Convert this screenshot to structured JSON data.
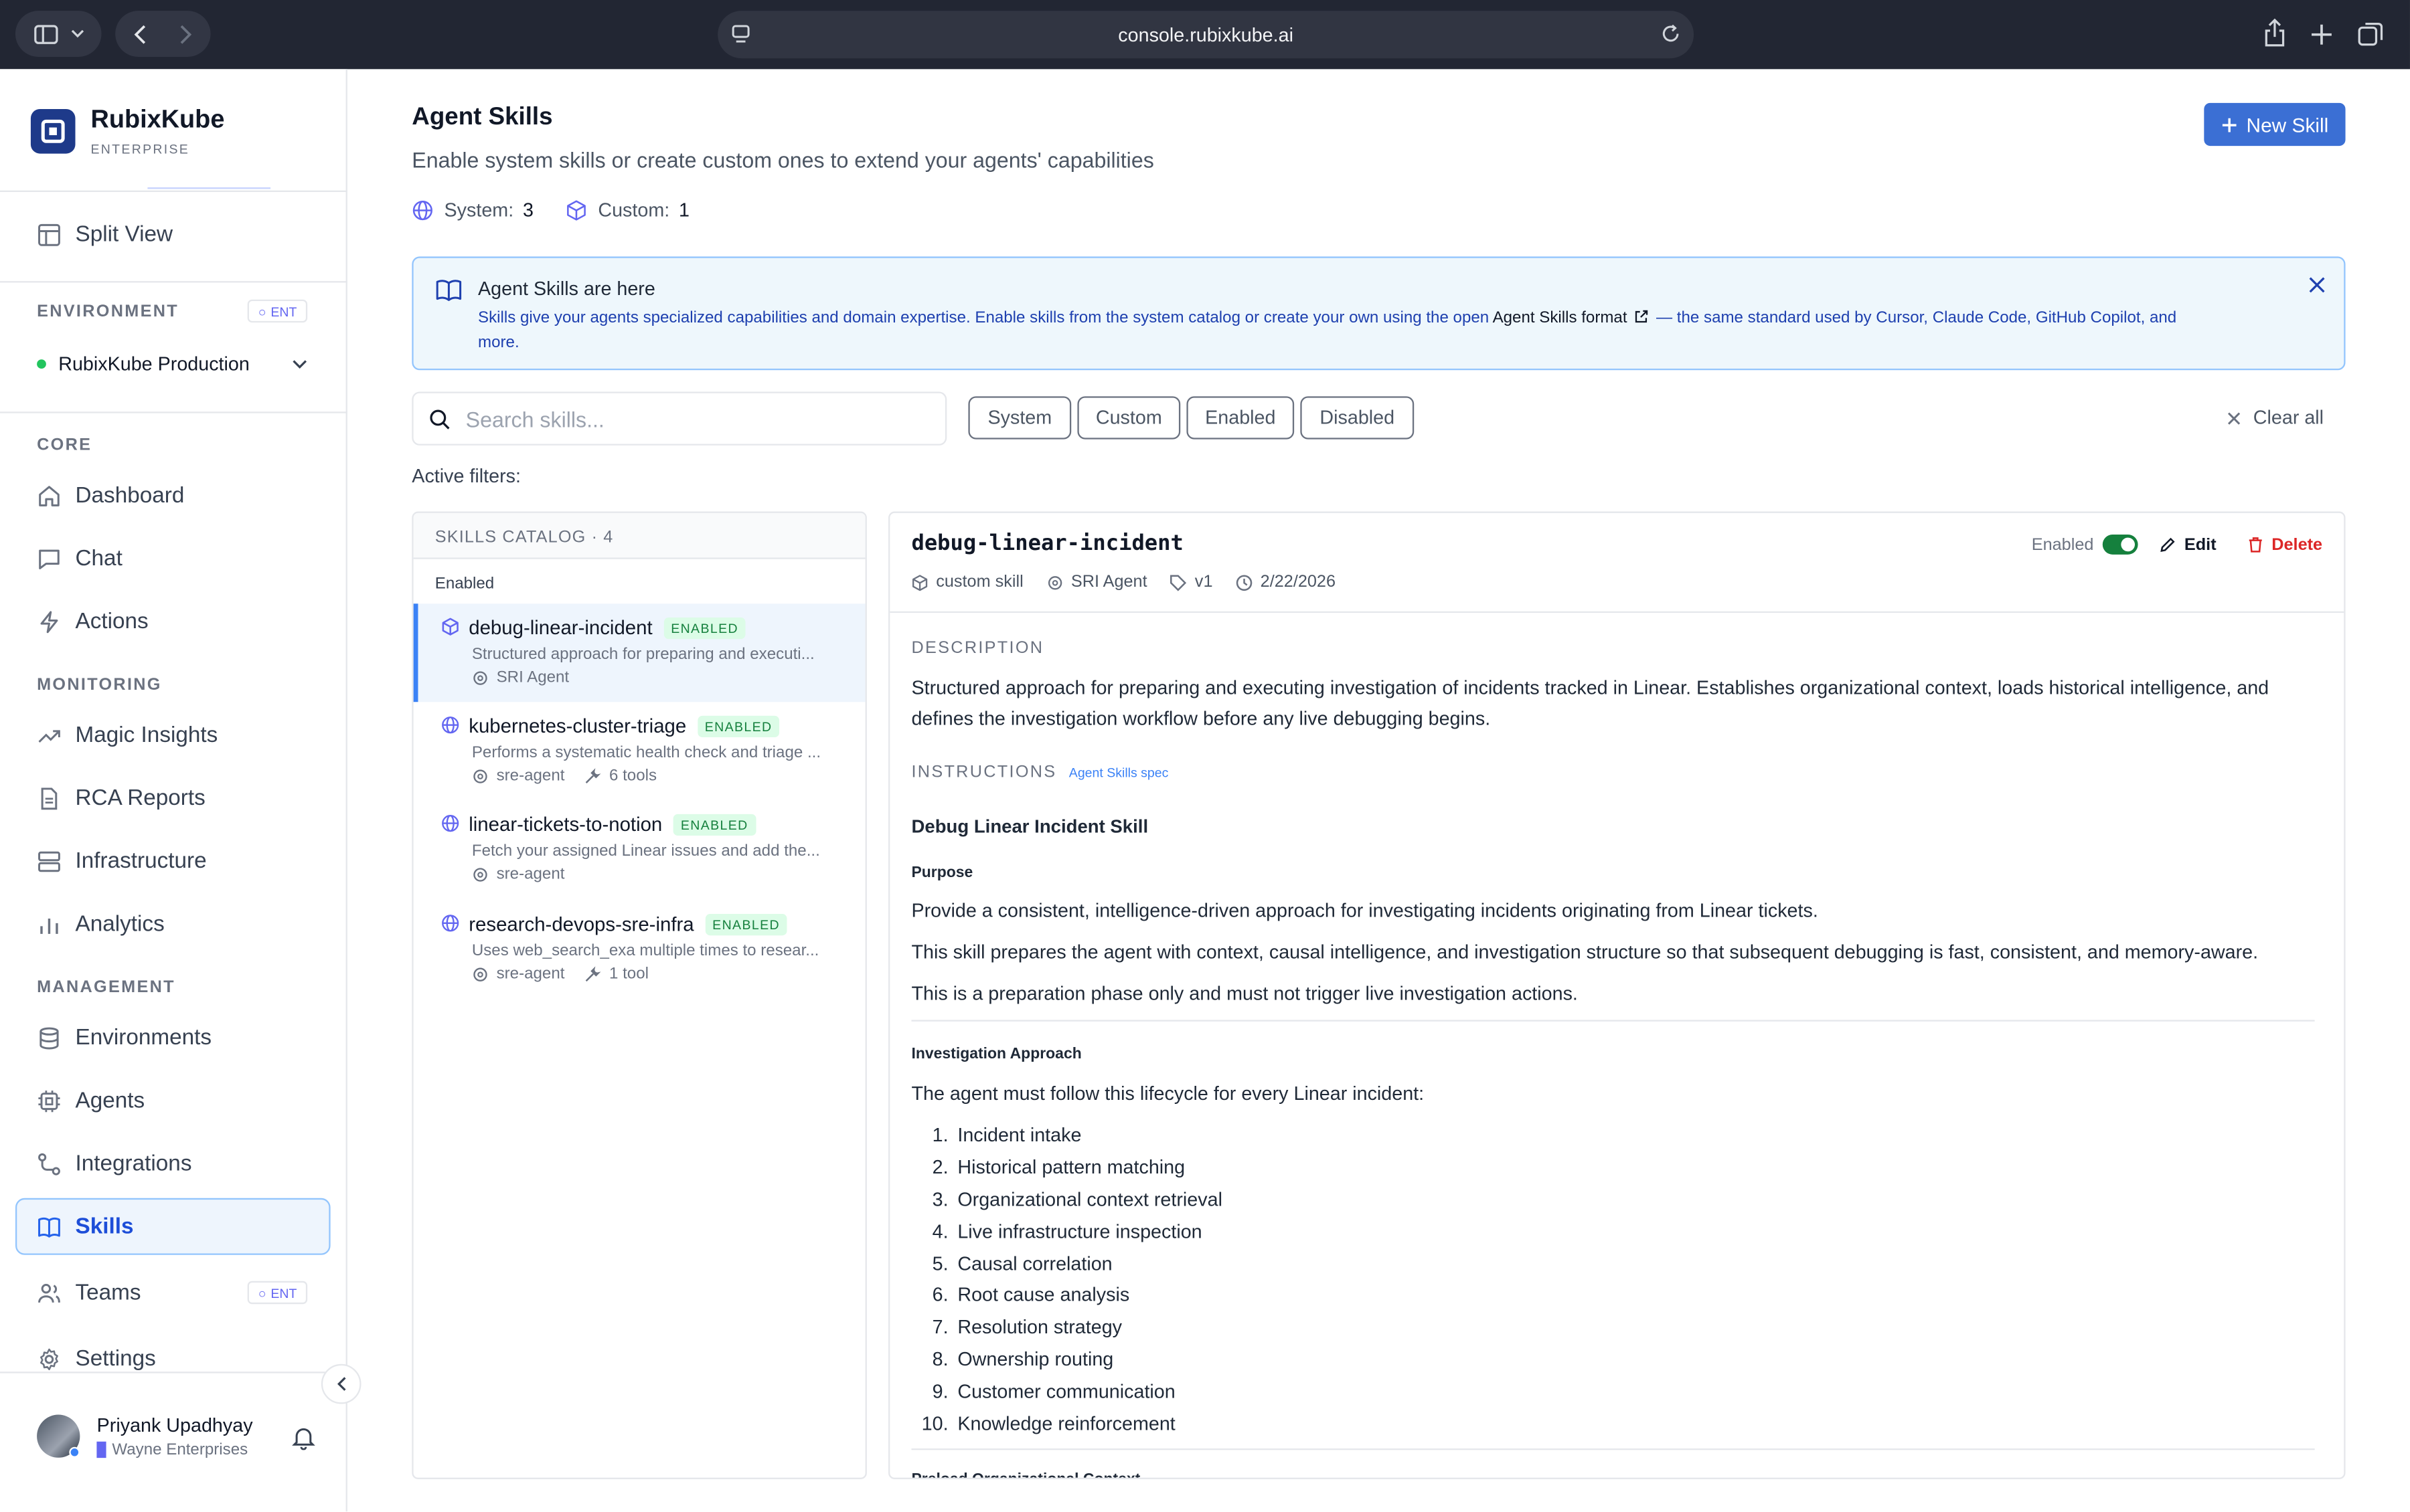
{
  "browser": {
    "url": "console.rubixkube.ai"
  },
  "brand": {
    "name": "RubixKube",
    "edition": "ENTERPRISE"
  },
  "sidebar": {
    "split_view": "Split View",
    "environment_label": "ENVIRONMENT",
    "ent_badge": "ENT",
    "environment_value": "RubixKube Production",
    "core_label": "CORE",
    "monitoring_label": "MONITORING",
    "management_label": "MANAGEMENT",
    "items": {
      "dashboard": "Dashboard",
      "chat": "Chat",
      "actions": "Actions",
      "magic": "Magic Insights",
      "rca": "RCA Reports",
      "infra": "Infrastructure",
      "analytics": "Analytics",
      "environments": "Environments",
      "agents": "Agents",
      "integrations": "Integrations",
      "skills": "Skills",
      "teams": "Teams",
      "settings": "Settings"
    },
    "user": {
      "name": "Priyank Upadhyay",
      "org": "Wayne Enterprises"
    }
  },
  "page": {
    "title": "Agent Skills",
    "subtitle": "Enable system skills or create custom ones to extend your agents' capabilities",
    "system_label": "System:",
    "system_count": "3",
    "custom_label": "Custom:",
    "custom_count": "1",
    "new_button": "New Skill"
  },
  "banner": {
    "title": "Agent Skills are here",
    "text_1": "Skills give your agents specialized capabilities and domain expertise. Enable skills from the system catalog or create your own using the open ",
    "link": "Agent Skills format",
    "text_2": " — the same standard used by Cursor, Claude Code, GitHub Copilot, and",
    "text_3": "more."
  },
  "filters": {
    "search_placeholder": "Search skills...",
    "chips": [
      "System",
      "Custom",
      "Enabled",
      "Disabled"
    ],
    "clear_all": "Clear all",
    "active_label": "Active filters:"
  },
  "catalog": {
    "header": "SKILLS CATALOG · 4",
    "group": "Enabled",
    "items": [
      {
        "name": "debug-linear-incident",
        "badge": "ENABLED",
        "desc": "Structured approach for preparing and executi...",
        "agent": "SRI Agent",
        "tools": ""
      },
      {
        "name": "kubernetes-cluster-triage",
        "badge": "ENABLED",
        "desc": "Performs a systematic health check and triage ...",
        "agent": "sre-agent",
        "tools": "6 tools"
      },
      {
        "name": "linear-tickets-to-notion",
        "badge": "ENABLED",
        "desc": "Fetch your assigned Linear issues and add the...",
        "agent": "sre-agent",
        "tools": ""
      },
      {
        "name": "research-devops-sre-infra",
        "badge": "ENABLED",
        "desc": "Uses web_search_exa multiple times to resear...",
        "agent": "sre-agent",
        "tools": "1 tool"
      }
    ]
  },
  "detail": {
    "name": "debug-linear-incident",
    "enabled_label": "Enabled",
    "edit": "Edit",
    "delete": "Delete",
    "kind": "custom skill",
    "agent": "SRI Agent",
    "version": "v1",
    "date": "2/22/2026",
    "description_label": "DESCRIPTION",
    "description_1": "Structured approach for preparing and executing investigation of incidents tracked in Linear. Establishes organizational context, loads historical intelligence, and",
    "description_2": "defines the investigation workflow before any live debugging begins.",
    "instructions_label": "INSTRUCTIONS",
    "spec_link": "Agent Skills spec",
    "h1": "Debug Linear Incident Skill",
    "purpose": "Purpose",
    "p1": "Provide a consistent, intelligence-driven approach for investigating incidents originating from Linear tickets.",
    "p2": "This skill prepares the agent with context, causal intelligence, and investigation structure so that subsequent debugging is fast, consistent, and memory-aware.",
    "p3": "This is a preparation phase only and must not trigger live investigation actions.",
    "h2": "Investigation Approach",
    "p4": "The agent must follow this lifecycle for every Linear incident:",
    "steps": [
      "Incident intake",
      "Historical pattern matching",
      "Organizational context retrieval",
      "Live infrastructure inspection",
      "Causal correlation",
      "Root cause analysis",
      "Resolution strategy",
      "Ownership routing",
      "Customer communication",
      "Knowledge reinforcement"
    ],
    "cut_heading": "Preload Organizational Context"
  },
  "colors": {
    "accent": "#3b6fd4",
    "enabled_green": "#15803d",
    "delete_red": "#dc2626",
    "brand": "#1e3a8a"
  }
}
